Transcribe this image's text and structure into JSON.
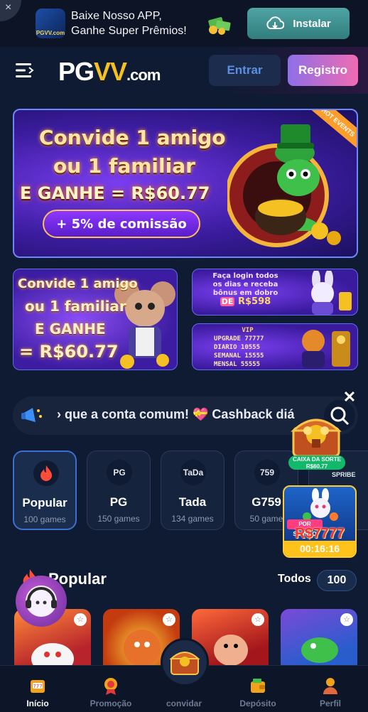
{
  "app_banner": {
    "close_glyph": "×",
    "logo_text": "PGVV.com",
    "line1": "Baixe Nosso APP,",
    "line2": "Ganhe Super Prêmios!",
    "install_label": "Instalar",
    "install_icon": "cloud-download-icon"
  },
  "header": {
    "logo_main": "PG",
    "logo_vv": "VV",
    "logo_suffix": ".com",
    "login_label": "Entrar",
    "register_label": "Registro"
  },
  "promos": {
    "main": {
      "line1": "Convide 1 amigo",
      "line2": "ou 1 familiar",
      "line3": "E GANHE = R$60.77",
      "commission": "+ 5% de comissão",
      "hot_badge": "HOT EVENTS"
    },
    "left": {
      "line1": "Convide 1 amigo",
      "line2": "ou 1 familiar",
      "line3": "E GANHE",
      "line4": "= R$60.77"
    },
    "right_top": {
      "line1": "Faça login todos",
      "line2": "os dias e receba",
      "line3": "bônus em dobro",
      "prefix": "DE",
      "amount": "R$598"
    },
    "right_bottom": {
      "title": "VIP",
      "rows": [
        "UPGRADE 77777",
        "DIARIO 10555",
        "SEMANAL 15555",
        "MENSAL 55555"
      ]
    }
  },
  "marquee": {
    "text": "› que a conta comum! 💝 Cashback diá"
  },
  "categories": [
    {
      "name": "Popular",
      "count": "100 games",
      "icon": "flame-icon"
    },
    {
      "name": "PG",
      "count": "150 games",
      "icon_text": "PG"
    },
    {
      "name": "Tada",
      "count": "134 games",
      "icon_text": "TaDa"
    },
    {
      "name": "G759",
      "count": "50 game",
      "icon_text": "759"
    }
  ],
  "widgets": {
    "close_glyph": "✕",
    "chest_label": "CAIXA DA SORTE R$60.77",
    "spribe": "SPRIBE",
    "session_tag": "POR SESSÃO",
    "session_amount": "R$7777",
    "session_timer": "00:16:16"
  },
  "section": {
    "title": "Popular",
    "all_label": "Todos",
    "all_count": "100"
  },
  "bottom_nav": [
    {
      "label": "Início",
      "icon": "slot-machine-icon"
    },
    {
      "label": "Promoção",
      "icon": "medal-icon"
    },
    {
      "label": "convidar",
      "icon": "treasure-chest-icon"
    },
    {
      "label": "Depósito",
      "icon": "wallet-icon"
    },
    {
      "label": "Perfil",
      "icon": "user-icon"
    }
  ],
  "colors": {
    "background": "#0f1a33",
    "accent_blue": "#5c8fe0",
    "register_gradient_start": "#8e6fe8",
    "register_gradient_end": "#ef6bb2",
    "gold": "#f4c022"
  }
}
